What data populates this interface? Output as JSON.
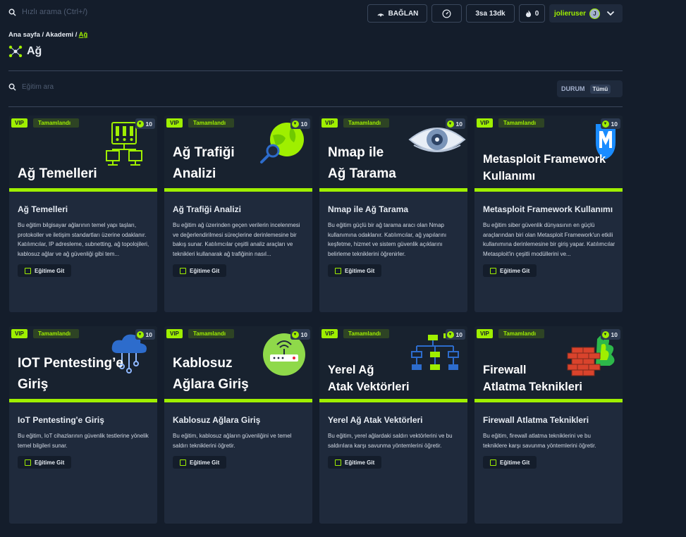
{
  "header": {
    "search_placeholder": "Hızlı arama (Ctrl+/)",
    "connect_label": "BAĞLAN",
    "timer_label": "3sa 13dk",
    "streak_count": "0",
    "username": "jolieruser",
    "avatar_initial": "J"
  },
  "breadcrumb": {
    "home": "Ana sayfa",
    "sep1": " / ",
    "academy": "Akademi",
    "sep2": " / ",
    "current": "Ağ"
  },
  "page": {
    "title": "Ağ"
  },
  "filters": {
    "search_placeholder": "Eğitim ara",
    "status_label": "DURUM",
    "status_value": "Tümü"
  },
  "colors": {
    "accent": "#9fef00",
    "background": "#141d2b",
    "card": "#1f2a3c"
  },
  "cards": [
    {
      "vip": "VIP",
      "status": "Tamamlandı",
      "level": "10",
      "hero_line1": "Ağ Temelleri",
      "hero_line2": "",
      "title": "Ağ Temelleri",
      "icon": "server-network-icon",
      "description": "Bu eğitim bilgisayar ağlarının temel yapı taşları, protokoller ve iletişim standartları üzerine odaklanır. Katılımcılar, IP adresleme, subnetting, ağ topolojileri, kablosuz ağlar ve ağ güvenliği gibi tem...",
      "button": "Eğitime Git"
    },
    {
      "vip": "VIP",
      "status": "Tamamlandı",
      "level": "10",
      "hero_line1": "Ağ Trafiği",
      "hero_line2": "Analizi",
      "title": "Ağ Trafiği Analizi",
      "icon": "globe-magnifier-icon",
      "description": "Bu eğitim ağ üzerinden geçen verilerin incelenmesi ve değerlendirilmesi süreçlerine derinlemesine bir bakış sunar. Katılımcılar çeşitli analiz araçları ve teknikleri kullanarak ağ trafiğinin nasıl...",
      "button": "Eğitime Git"
    },
    {
      "vip": "VIP",
      "status": "Tamamlandı",
      "level": "10",
      "hero_line1": "Nmap ile",
      "hero_line2": "Ağ Tarama",
      "title": "Nmap ile Ağ Tarama",
      "icon": "eye-icon",
      "description": "Bu eğitim güçlü bir ağ tarama aracı olan Nmap kullanımına odaklanır. Katılımcılar, ağ yapılarını keşfetme, hizmet ve sistem güvenlik açıklarını belirleme tekniklerini öğrenirler.",
      "button": "Eğitime Git"
    },
    {
      "vip": "VIP",
      "status": "Tamamlandı",
      "level": "10",
      "hero_line1": "Metasploit Framework",
      "hero_line2": "Kullanımı",
      "title": "Metasploit Framework Kullanımı",
      "icon": "metasploit-icon",
      "description": "Bu eğitim siber güvenlik dünyasının en güçlü araçlarından biri olan Metasploit Framework'un etkili kullanımına derinlemesine bir giriş yapar. Katılımcılar Metasploit'in çeşitli modüllerini ve...",
      "button": "Eğitime Git"
    },
    {
      "vip": "VIP",
      "status": "Tamamlandı",
      "level": "10",
      "hero_line1": "IOT Pentesting’e",
      "hero_line2": "Giriş",
      "title": "IoT Pentesting'e Giriş",
      "icon": "cloud-circuit-icon",
      "description": "Bu eğitim, IoT cihazlarının güvenlik testlerine yönelik temel bilgileri sunar.",
      "button": "Eğitime Git"
    },
    {
      "vip": "VIP",
      "status": "Tamamlandı",
      "level": "10",
      "hero_line1": "Kablosuz",
      "hero_line2": "Ağlara Giriş",
      "title": "Kablosuz Ağlara Giriş",
      "icon": "wifi-router-icon",
      "description": "Bu eğitim, kablosuz ağların güvenliğini ve temel saldırı tekniklerini öğretir.",
      "button": "Eğitime Git"
    },
    {
      "vip": "VIP",
      "status": "Tamamlandı",
      "level": "10",
      "hero_line1": "Yerel Ağ",
      "hero_line2": "Atak Vektörleri",
      "title": "Yerel Ağ Atak Vektörleri",
      "icon": "network-topology-icon",
      "description": "Bu eğitim, yerel ağlardaki saldırı vektörlerini ve bu saldırılara karşı savunma yöntemlerini öğretir.",
      "button": "Eğitime Git"
    },
    {
      "vip": "VIP",
      "status": "Tamamlandı",
      "level": "10",
      "hero_line1": "Firewall",
      "hero_line2": "Atlatma Teknikleri",
      "title": "Firewall Atlatma Teknikleri",
      "icon": "firewall-icon",
      "description": "Bu eğitim, firewall atlatma tekniklerini ve bu tekniklere karşı savunma yöntemlerini öğretir.",
      "button": "Eğitime Git"
    }
  ]
}
